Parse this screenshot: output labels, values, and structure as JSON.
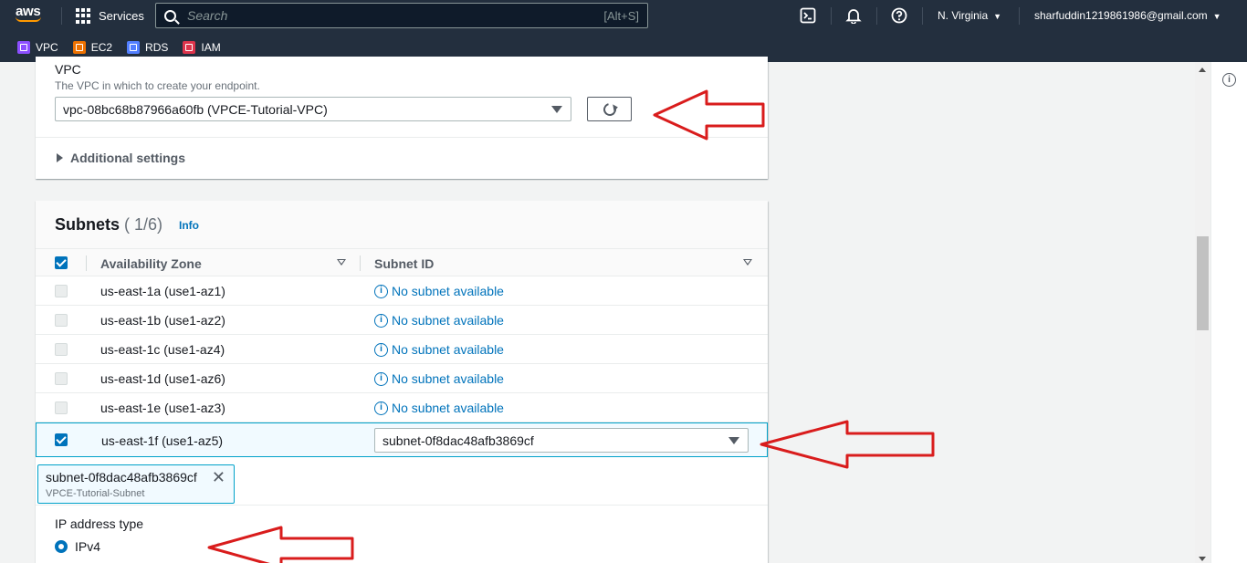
{
  "topbar": {
    "logo_text": "aws",
    "services_label": "Services",
    "search_placeholder": "Search",
    "search_shortcut": "[Alt+S]",
    "region": "N. Virginia",
    "account": "sharfuddin1219861986@gmail.com"
  },
  "favorites": [
    {
      "label": "VPC",
      "color": "#8c4fff"
    },
    {
      "label": "EC2",
      "color": "#ed7100"
    },
    {
      "label": "RDS",
      "color": "#527fff"
    },
    {
      "label": "IAM",
      "color": "#dd344c"
    }
  ],
  "vpc": {
    "label": "VPC",
    "description": "The VPC in which to create your endpoint.",
    "selected": "vpc-08bc68b87966a60fb (VPCE-Tutorial-VPC)"
  },
  "additional_settings": "Additional settings",
  "subnets": {
    "title": "Subnets",
    "count": "( 1/6)",
    "info": "Info",
    "columns": {
      "az": "Availability Zone",
      "subnet": "Subnet ID"
    },
    "rows": [
      {
        "az": "us-east-1a (use1-az1)",
        "subnet": "No subnet available",
        "checked": false
      },
      {
        "az": "us-east-1b (use1-az2)",
        "subnet": "No subnet available",
        "checked": false
      },
      {
        "az": "us-east-1c (use1-az4)",
        "subnet": "No subnet available",
        "checked": false
      },
      {
        "az": "us-east-1d (use1-az6)",
        "subnet": "No subnet available",
        "checked": false
      },
      {
        "az": "us-east-1e (use1-az3)",
        "subnet": "No subnet available",
        "checked": false
      },
      {
        "az": "us-east-1f (use1-az5)",
        "subnet": "subnet-0f8dac48afb3869cf",
        "checked": true
      }
    ],
    "token": {
      "id": "subnet-0f8dac48afb3869cf",
      "name": "VPCE-Tutorial-Subnet"
    }
  },
  "ip_address_type": {
    "label": "IP address type",
    "selected": "IPv4"
  },
  "colors": {
    "nav_bg": "#232f3e",
    "link": "#0073bb",
    "selection_border": "#00a1c9",
    "annotation_arrow": "#d91c1c"
  }
}
